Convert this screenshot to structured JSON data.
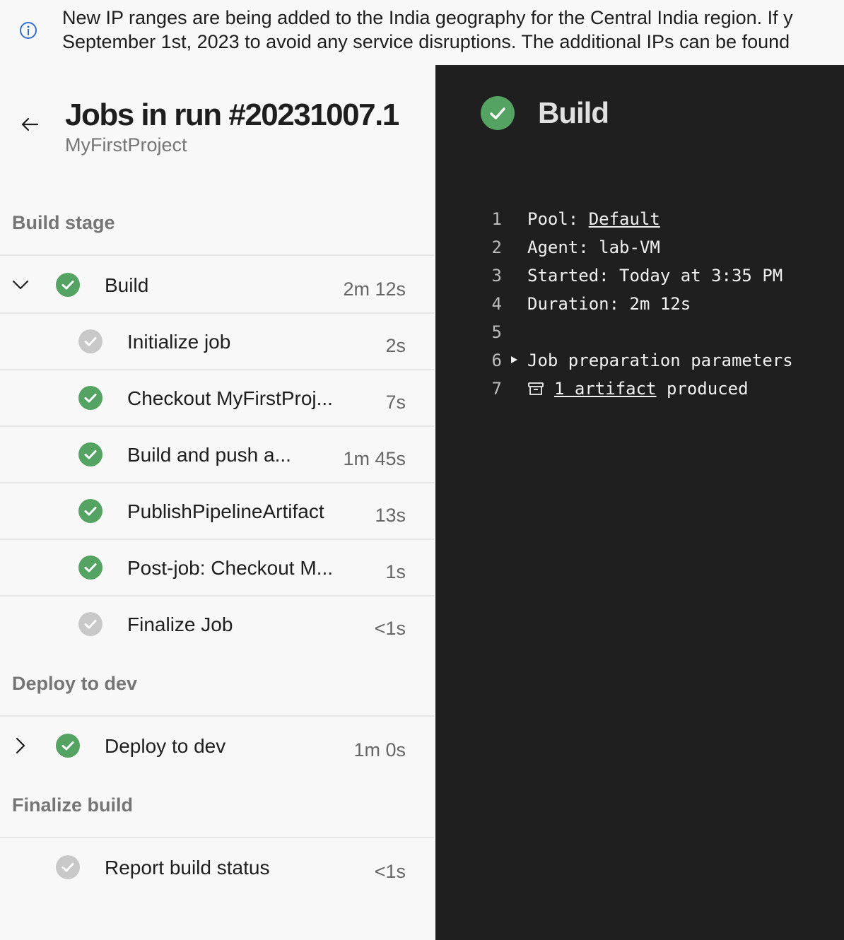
{
  "banner": {
    "line1": "New IP ranges are being added to the India geography for the Central India region. If y",
    "line2": "September 1st, 2023 to avoid any service disruptions. The additional IPs can be found"
  },
  "header": {
    "title": "Jobs in run #20231007.1",
    "project": "MyFirstProject"
  },
  "stages": {
    "build": {
      "label": "Build stage",
      "job": {
        "name": "Build",
        "duration": "2m 12s",
        "status": "succeeded"
      },
      "steps": [
        {
          "name": "Initialize job",
          "duration": "2s",
          "status": "skipped"
        },
        {
          "name": "Checkout MyFirstProj...",
          "duration": "7s",
          "status": "succeeded"
        },
        {
          "name": "Build and push a...",
          "duration": "1m 45s",
          "status": "succeeded"
        },
        {
          "name": "PublishPipelineArtifact",
          "duration": "13s",
          "status": "succeeded"
        },
        {
          "name": "Post-job: Checkout M...",
          "duration": "1s",
          "status": "succeeded"
        },
        {
          "name": "Finalize Job",
          "duration": "<1s",
          "status": "skipped"
        }
      ]
    },
    "deploy": {
      "label": "Deploy to dev",
      "job": {
        "name": "Deploy to dev",
        "duration": "1m 0s",
        "status": "succeeded"
      }
    },
    "finalize": {
      "label": "Finalize build",
      "job": {
        "name": "Report build status",
        "duration": "<1s",
        "status": "skipped"
      }
    }
  },
  "detail": {
    "title": "Build",
    "log": {
      "n1": "1",
      "n2": "2",
      "n3": "3",
      "n4": "4",
      "n5": "5",
      "n6": "6",
      "n7": "7",
      "pool_key": "Pool: ",
      "pool_value": "Default",
      "agent": "Agent: lab-VM",
      "started": "Started: Today at 3:35 PM",
      "duration": "Duration: 2m 12s",
      "job_params": "Job preparation parameters",
      "artifact_link": "1 artifact",
      "artifact_suffix": " produced"
    }
  },
  "colors": {
    "success": "#55a362",
    "skipped": "#c8c8c8",
    "log_bg": "#1f1f1f",
    "info_blue": "#2f6fce"
  }
}
